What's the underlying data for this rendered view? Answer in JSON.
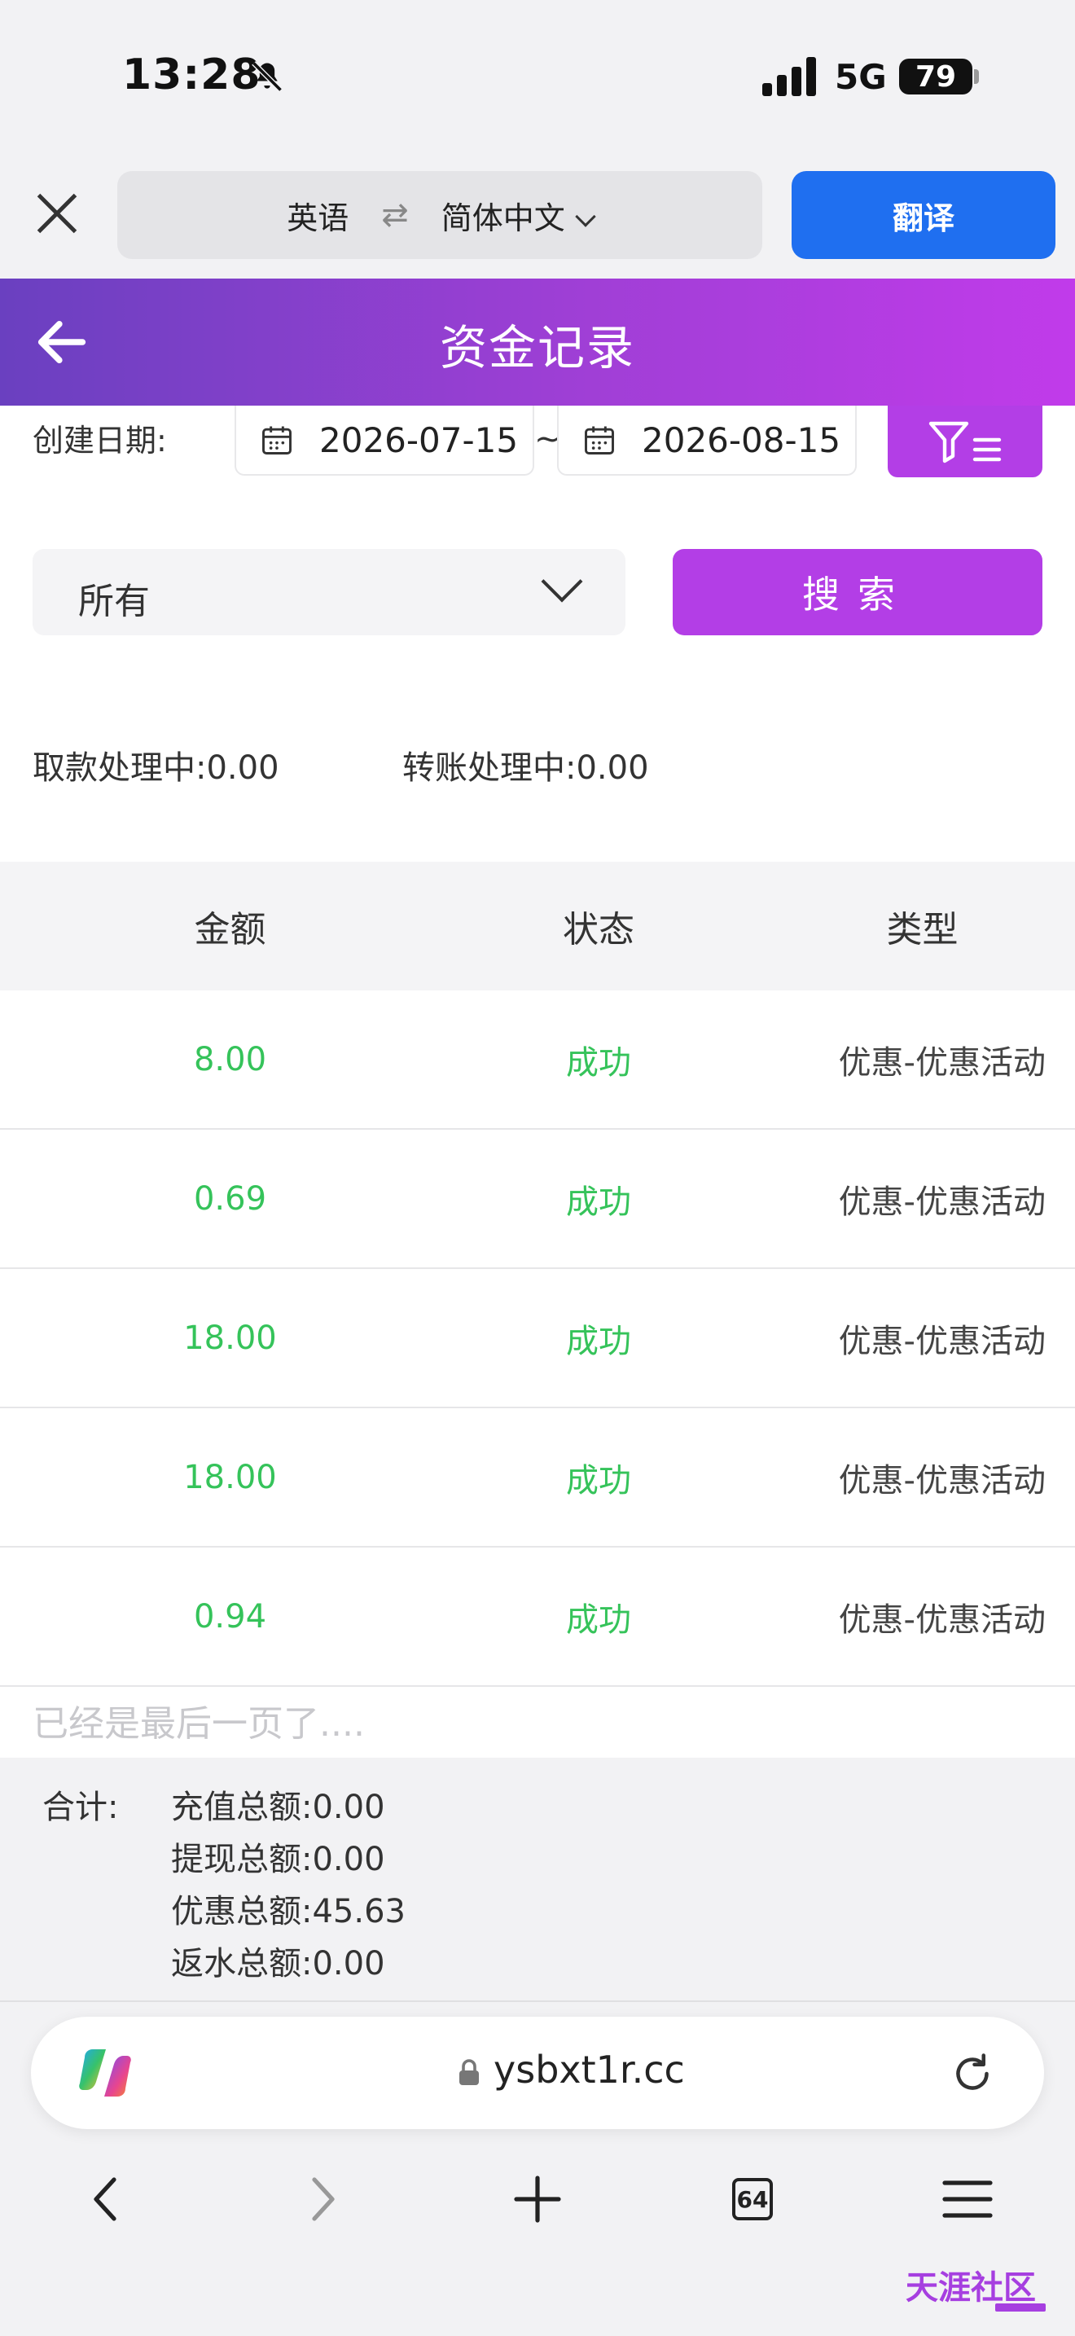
{
  "status_bar": {
    "time": "13:28",
    "network": "5G",
    "battery": "79"
  },
  "translate_bar": {
    "source_lang": "英语",
    "swap_symbol": "⇄",
    "target_lang": "简体中文",
    "translate_label": "翻译"
  },
  "header": {
    "title": "资金记录"
  },
  "filters": {
    "date_label": "创建日期:",
    "date_from": "2026-07-15",
    "date_separator": "~",
    "date_to": "2026-08-15",
    "type_selected": "所有",
    "search_label": "搜索"
  },
  "pending": {
    "withdraw_label": "取款处理中:",
    "withdraw_value": "0.00",
    "transfer_label": "转账处理中:",
    "transfer_value": "0.00"
  },
  "table": {
    "headers": [
      "金额",
      "状态",
      "类型"
    ],
    "rows": [
      {
        "amount": "8.00",
        "status": "成功",
        "type": "优惠-优惠活动"
      },
      {
        "amount": "0.69",
        "status": "成功",
        "type": "优惠-优惠活动"
      },
      {
        "amount": "18.00",
        "status": "成功",
        "type": "优惠-优惠活动"
      },
      {
        "amount": "18.00",
        "status": "成功",
        "type": "优惠-优惠活动"
      },
      {
        "amount": "0.94",
        "status": "成功",
        "type": "优惠-优惠活动"
      }
    ],
    "end_note": "已经是最后一页了...."
  },
  "totals": {
    "label": "合计:",
    "lines": [
      {
        "label": "充值总额:",
        "value": "0.00"
      },
      {
        "label": "提现总额:",
        "value": "0.00"
      },
      {
        "label": "优惠总额:",
        "value": "45.63"
      },
      {
        "label": "返水总额:",
        "value": "0.00"
      }
    ]
  },
  "browser": {
    "url": "ysbxt1r.cc",
    "tab_count": "64"
  },
  "colors": {
    "accent_purple": "#b33ee6",
    "header_start": "#6a40c0",
    "translate_blue": "#1f6ff0",
    "success_green": "#35c35a"
  },
  "icons": [
    "bell-off-icon",
    "signal-icon",
    "close-icon",
    "swap-icon",
    "chevron-down-icon",
    "back-arrow-icon",
    "calendar-icon",
    "filter-icon",
    "copilot-icon",
    "lock-icon",
    "reload-icon",
    "nav-back-icon",
    "nav-forward-icon",
    "new-tab-icon",
    "tabs-icon",
    "menu-icon"
  ]
}
